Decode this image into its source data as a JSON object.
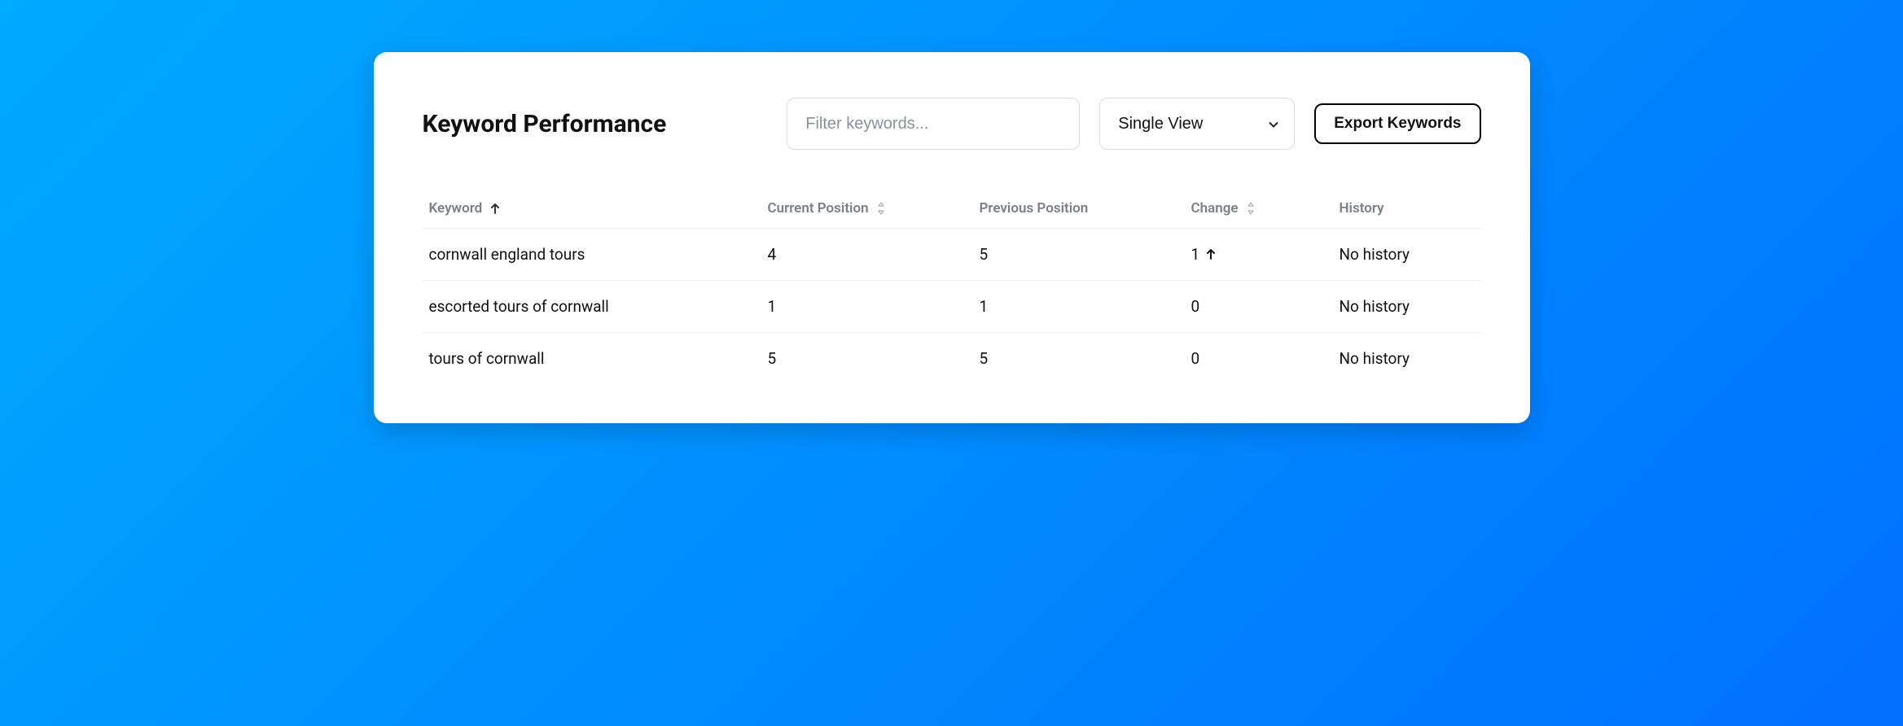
{
  "title": "Keyword Performance",
  "filter": {
    "placeholder": "Filter keywords..."
  },
  "view_select": {
    "selected": "Single View"
  },
  "export_button": "Export Keywords",
  "columns": {
    "keyword": "Keyword",
    "current": "Current Position",
    "previous": "Previous Position",
    "change": "Change",
    "history": "History"
  },
  "rows": [
    {
      "keyword": "cornwall england tours",
      "current": "4",
      "previous": "5",
      "change": "1",
      "direction": "up",
      "history": "No history"
    },
    {
      "keyword": "escorted tours of cornwall",
      "current": "1",
      "previous": "1",
      "change": "0",
      "direction": "none",
      "history": "No history"
    },
    {
      "keyword": "tours of cornwall",
      "current": "5",
      "previous": "5",
      "change": "0",
      "direction": "none",
      "history": "No history"
    }
  ]
}
